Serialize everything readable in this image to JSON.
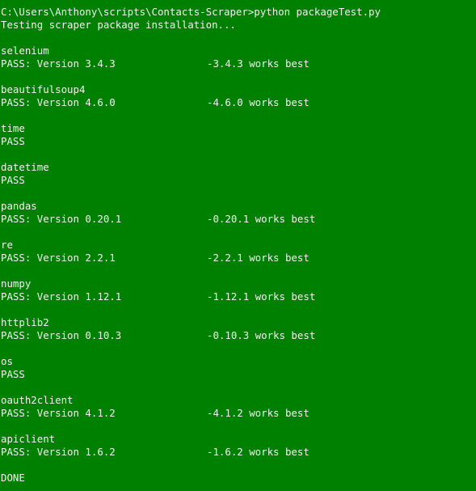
{
  "console": {
    "background": "#008000",
    "foreground": "#f2f2f2",
    "prompt": "C:\\Users\\Anthony\\scripts\\Contacts-Scraper>python packageTest.py",
    "intro": "Testing scraper package installation...",
    "done": "DONE",
    "packages": [
      {
        "name": "selenium",
        "status": "PASS: Version 3.4.3",
        "hint": "-3.4.3 works best"
      },
      {
        "name": "beautifulsoup4",
        "status": "PASS: Version 4.6.0",
        "hint": "-4.6.0 works best"
      },
      {
        "name": "time",
        "status": "PASS",
        "hint": ""
      },
      {
        "name": "datetime",
        "status": "PASS",
        "hint": ""
      },
      {
        "name": "pandas",
        "status": "PASS: Version 0.20.1",
        "hint": "-0.20.1 works best"
      },
      {
        "name": "re",
        "status": "PASS: Version 2.2.1",
        "hint": "-2.2.1 works best"
      },
      {
        "name": "numpy",
        "status": "PASS: Version 1.12.1",
        "hint": "-1.12.1 works best"
      },
      {
        "name": "httplib2",
        "status": "PASS: Version 0.10.3",
        "hint": "-0.10.3 works best"
      },
      {
        "name": "os",
        "status": "PASS",
        "hint": ""
      },
      {
        "name": "oauth2client",
        "status": "PASS: Version 4.1.2",
        "hint": "-4.1.2 works best"
      },
      {
        "name": "apiclient",
        "status": "PASS: Version 1.6.2",
        "hint": "-1.6.2 works best"
      }
    ]
  }
}
